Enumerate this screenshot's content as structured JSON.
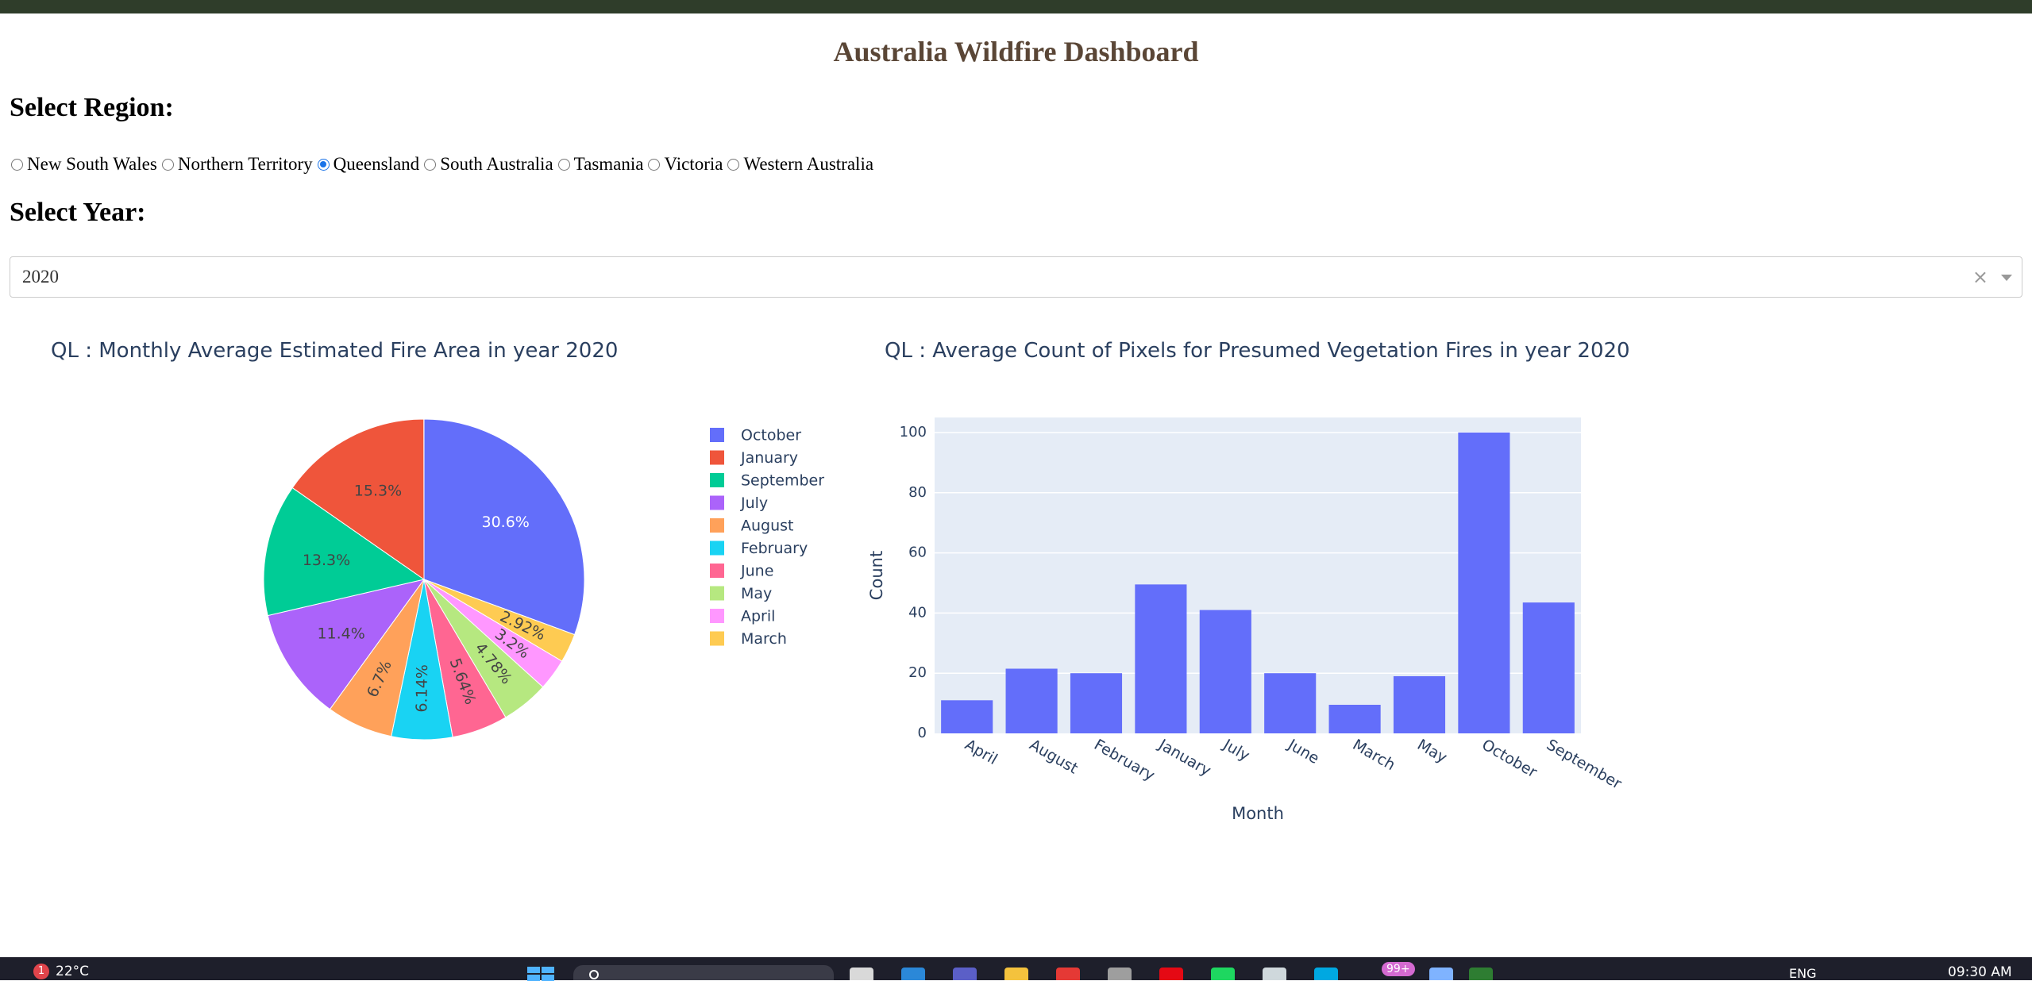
{
  "page": {
    "title": "Australia Wildfire Dashboard"
  },
  "region": {
    "heading": "Select Region:",
    "options": [
      "New South Wales",
      "Northern Territory",
      "Queensland",
      "South Australia",
      "Tasmania",
      "Victoria",
      "Western Australia"
    ],
    "selected": "Queensland"
  },
  "year": {
    "heading": "Select Year:",
    "value": "2020",
    "clear_glyph": "×"
  },
  "pie_chart": {
    "title": "QL : Monthly Average Estimated Fire Area in year 2020"
  },
  "bar_chart": {
    "title": "QL : Average Count of Pixels for Presumed Vegetation Fires in year 2020"
  },
  "chart_data": [
    {
      "type": "pie",
      "title": "QL : Monthly Average Estimated Fire Area in year 2020",
      "legend_position": "right",
      "slices": [
        {
          "label": "October",
          "percent": 30.6,
          "text": "30.6%",
          "color": "#636efa"
        },
        {
          "label": "March",
          "percent": 2.92,
          "text": "2.92%",
          "color": "#fecb52"
        },
        {
          "label": "April",
          "percent": 3.2,
          "text": "3.2%",
          "color": "#ff97ff"
        },
        {
          "label": "May",
          "percent": 4.78,
          "text": "4.78%",
          "color": "#b6e880"
        },
        {
          "label": "June",
          "percent": 5.64,
          "text": "5.64%",
          "color": "#ff6692"
        },
        {
          "label": "February",
          "percent": 6.14,
          "text": "6.14%",
          "color": "#19d3f3"
        },
        {
          "label": "August",
          "percent": 6.7,
          "text": "6.7%",
          "color": "#ffa15a"
        },
        {
          "label": "July",
          "percent": 11.4,
          "text": "11.4%",
          "color": "#ab63fa"
        },
        {
          "label": "September",
          "percent": 13.3,
          "text": "13.3%",
          "color": "#00cc96"
        },
        {
          "label": "January",
          "percent": 15.3,
          "text": "15.3%",
          "color": "#ef553b"
        }
      ],
      "legend": [
        "October",
        "January",
        "September",
        "July",
        "August",
        "February",
        "June",
        "May",
        "April",
        "March"
      ]
    },
    {
      "type": "bar",
      "title": "QL : Average Count of Pixels for Presumed Vegetation Fires in year 2020",
      "xlabel": "Month",
      "ylabel": "Count",
      "categories": [
        "April",
        "August",
        "February",
        "January",
        "July",
        "June",
        "March",
        "May",
        "October",
        "September"
      ],
      "values": [
        11,
        21.5,
        20,
        49.5,
        41,
        20,
        9.5,
        19,
        100,
        43.5
      ],
      "ylim": [
        0,
        105
      ],
      "yticks": [
        0,
        20,
        40,
        60,
        80,
        100
      ],
      "grid": true,
      "color": "#636efa",
      "plot_bg": "#e5ecf6"
    }
  ],
  "taskbar": {
    "weather_badge": "1",
    "temperature": "22°C",
    "notification_count": "99+",
    "language": "ENG",
    "time": "09:30 AM"
  }
}
